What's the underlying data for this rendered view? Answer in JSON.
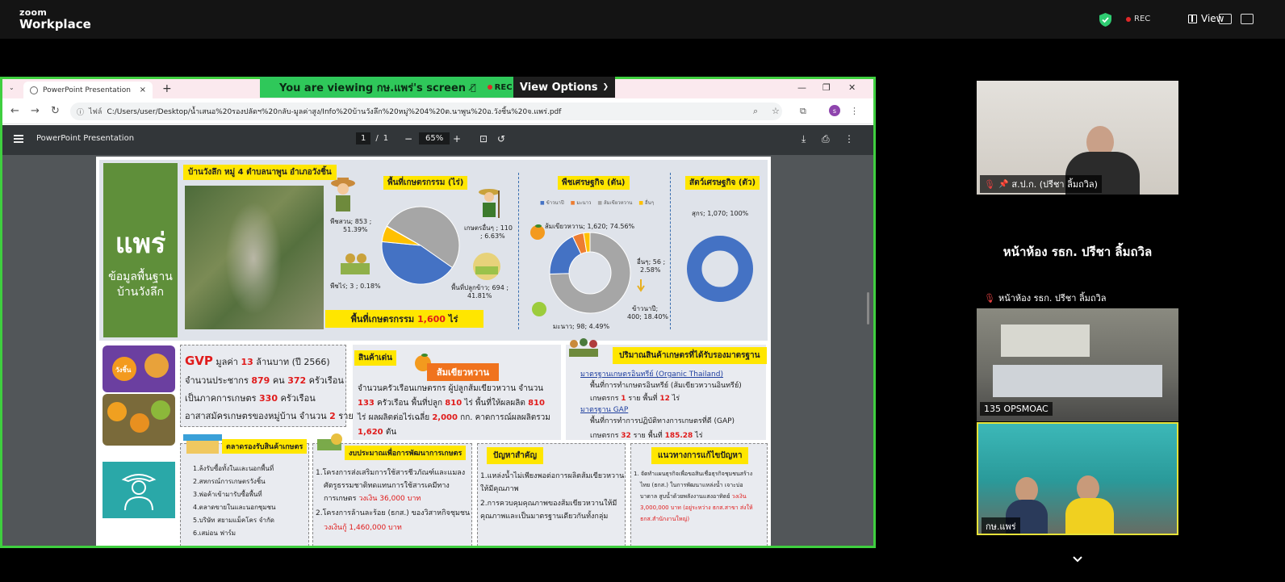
{
  "zoom": {
    "logo_small": "zoom",
    "logo_big": "Workplace",
    "rec_label": "REC",
    "view_label": "View",
    "colors": {
      "share_border": "#3fcf3f",
      "rec": "#e02828"
    }
  },
  "share": {
    "banner_text": "You are viewing  กษ.แพร่'s screen",
    "banner_rec": "REC",
    "view_options_label": "View Options"
  },
  "browser": {
    "tab_title": "PowerPoint Presentation",
    "tab_close": "×",
    "new_tab": "+",
    "url_info": "ไฟล์",
    "url": "C:/Users/user/Desktop/น้ำเสนอ%20รองปลัดฯ%20กลับ-มูลค่าสูง/Info%20บ้านวังลึก%20หมู่%204%20ต.นาพูน%20อ.วังชิ้น%20จ.แพร่.pdf",
    "avatar_letter": "s"
  },
  "pdf": {
    "title": "PowerPoint Presentation",
    "page_current": "1",
    "page_sep": "/",
    "page_total": "1",
    "zoom": "65%"
  },
  "info": {
    "province": "แพร่",
    "province_sub1": "ข้อมูลพื้นฐาน",
    "province_sub2": "บ้านวังลึก",
    "village_header": "บ้านวังลึก หมู่ 4 ตำบลนาพูน อำเภอวังชิ้น",
    "farm_area_title": "พื้นที่เกษตรกรรม (ไร่)",
    "farm_total_prefix": "พื้นที่เกษตรกรรม",
    "farm_total_value": "1,600",
    "farm_total_unit": "ไร่",
    "econ_crop_title": "พืชเศรษฐกิจ (ตัน)",
    "econ_animal_title": "สัตว์เศรษฐกิจ (ตัว)",
    "legend": [
      "ข้าวนาปี",
      "มะนาว",
      "ส้มเขียวหวาน",
      "อื่นๆ"
    ],
    "pie_labels": {
      "garden": "พืชสวน; 853 ;",
      "garden_pct": "51.39%",
      "other": "เกษตรอื่นๆ ; 110",
      "other_pct": "; 6.63%",
      "field": "พืชไร่; 3 ; 0.18%",
      "rice": "พื้นที่ปลูกข้าว; 694 ;",
      "rice_pct": "41.81%"
    },
    "donut_labels": {
      "tangerine": "ส้มเขียวหวาน; 1,620; 74.56%",
      "others": "อื่นๆ; 56 ;",
      "others_pct": "2.58%",
      "rice": "ข้าวนาปี;",
      "rice_val": "400; 18.40%",
      "lime": "มะนาว; 98; 4.49%"
    },
    "pig_label": "สุกร; 1,070; 100%",
    "gvp_prefix": "GVP",
    "gvp_mid": " มูลค่า ",
    "gvp_value": "13",
    "gvp_suffix": " ล้านบาท (ปี 2566)",
    "pop_a": "จำนวนประชากร ",
    "pop_people": "879",
    "pop_b": " คน ",
    "pop_households": "372",
    "pop_c": " ครัวเรือน",
    "agri_a": "เป็นภาคการเกษตร ",
    "agri_value": "330",
    "agri_b": " ครัวเรือน",
    "vol_a": "อาสาสมัครเกษตรของหมู่บ้าน จำนวน ",
    "vol_value": "2",
    "vol_b": " ราย",
    "product_tag": "สินค้าเด่น",
    "product_name": "ส้มเขียวหวาน",
    "product_line1": "จำนวนครัวเรือนเกษตรกร ผู้ปลูกส้มเขียวหวาน จำนวน",
    "product_line2_v1": "133",
    "product_line2_a": " ครัวเรือน พื้นที่ปลูก ",
    "product_line2_v2": "810",
    "product_line2_b": " ไร่ พื้นที่ให้ผลผลิต ",
    "product_line2_v3": "810",
    "product_line3_a": "ไร่ ผลผลิตต่อไร่เฉลี่ย ",
    "product_line3_v": "2,000",
    "product_line3_b": " กก. คาดการณ์ผลผลิตรวม",
    "product_line4_v": "1,620",
    "product_line4_b": " ตัน",
    "std_title": "ปริมาณสินค้าเกษตรที่ได้รับรองมาตรฐาน",
    "std_organic": "มาตรฐานเกษตรอินทรีย์ (Organic Thailand)",
    "std_organic_desc": "พื้นที่การทำเกษตรอินทรีย์ (ส้มเขียวหวานอินทรีย์)",
    "std_organic_a": "เกษตรกร  ",
    "std_organic_v1": "1",
    "std_organic_b": "  ราย พื้นที่ ",
    "std_organic_v2": "12",
    "std_organic_c": "  ไร่",
    "std_gap": "มาตรฐาน GAP",
    "std_gap_desc": "พื้นที่การทำการปฏิบัติทางการเกษตรที่ดี (GAP)",
    "std_gap_a": "เกษตรกร  ",
    "std_gap_v1": "32",
    "std_gap_b": "  ราย พื้นที่ ",
    "std_gap_v2": "185.28",
    "std_gap_c": "  ไร่",
    "market_title": "ตลาดรองรับสินค้าเกษตร",
    "market_items": [
      "1.ล้งรับซื้อทั้งในและนอกพื้นที่",
      "2.สหกรณ์การเกษตรวังชิ้น",
      "3.พ่อค้าเข้ามารับซื้อพื้นที่",
      "4.ตลาดขายในและนอกชุมชน",
      "5.บริษัท สยามแม็คโคร จำกัด",
      "6.เสม่อน ฟาร์ม"
    ],
    "budget_title": "งบประมาณเพื่อการพัฒนาการเกษตร",
    "budget_1a": "1.โครงการส่งเสริมการใช้สารชีวภัณฑ์และแมลง",
    "budget_1b": "ศัตรูธรรมชาติทดแทนการใช้สารเคมีทาง",
    "budget_1c": "การเกษตร ",
    "budget_1v": "วงเงิน 36,000 บาท",
    "budget_2a": "2.โครงการล้านละร้อย (ธกส.) ของวิสาหกิจชุมชน",
    "budget_2v": "วงเงินกู้  1,460,000  บาท",
    "problem_title": "ปัญหาสำคัญ",
    "problem_1a": "1.แหล่งน้ำไม่เพียงพอต่อการผลิตส้มเขียวหวาน",
    "problem_1b": "ให้มีคุณภาพ",
    "problem_2a": "2.การควบคุมคุณภาพของส้มเขียวหวานให้มี",
    "problem_2b": "คุณภาพและเป็นมาตรฐานเดียวกันทั้งกลุ่ม",
    "solution_title": "แนวทางการแก้ไขปัญหา",
    "solution_1": "1. จัดทำแผนธุรกิจเพื่อขอสินเชื่อธุรกิจชุมชนสร้าง",
    "solution_2": "ไทย (ธกส.) ในการพัฒนาแหล่งน้ำ  เจาะบ่อ",
    "solution_3": "บาดาล สูบน้ำด้วยพลังงานแสงอาทิตย์ ",
    "solution_3v": "วงเงิน",
    "solution_4v": "3,000,000 บาท (อยู่ระหว่าง ธกส.สาขา ส่งให้",
    "solution_5v": "ธกส.สำนักงานใหญ่)",
    "wangchin_badge": "วังชิ้น"
  },
  "participants": [
    {
      "name": "ส.ป.ก. (ปรีชา ลิ้มถวิล)",
      "muted": true,
      "pinned": true
    },
    {
      "name": "หน้าห้อง รธก. ปรีชา ลิ้มถวิล",
      "muted": true,
      "big_name": "หน้าห้อง รธก. ปรีชา ลิ้มถวิล"
    },
    {
      "name": "135 OPSMOAC",
      "muted": false
    },
    {
      "name": "กษ.แพร่",
      "muted": false
    }
  ],
  "chart_data": [
    {
      "type": "pie",
      "title": "พื้นที่เกษตรกรรม (ไร่)",
      "categories": [
        "พืชสวน",
        "พื้นที่ปลูกข้าว",
        "เกษตรอื่นๆ",
        "พืชไร่"
      ],
      "values": [
        853,
        694,
        110,
        3
      ],
      "percent": [
        51.39,
        41.81,
        6.63,
        0.18
      ],
      "colors": [
        "#a6a6a6",
        "#4472c4",
        "#ffc000",
        "#ed7d31"
      ]
    },
    {
      "type": "pie",
      "title": "พืชเศรษฐกิจ (ตัน)",
      "categories": [
        "ส้มเขียวหวาน",
        "ข้าวนาปี",
        "มะนาว",
        "อื่นๆ"
      ],
      "values": [
        1620,
        400,
        98,
        56
      ],
      "percent": [
        74.56,
        18.4,
        4.49,
        2.58
      ],
      "colors": [
        "#a6a6a6",
        "#4472c4",
        "#ed7d31",
        "#ffc000"
      ]
    },
    {
      "type": "pie",
      "title": "สัตว์เศรษฐกิจ (ตัว)",
      "categories": [
        "สุกร"
      ],
      "values": [
        1070
      ],
      "percent": [
        100
      ],
      "colors": [
        "#4472c4"
      ]
    }
  ]
}
